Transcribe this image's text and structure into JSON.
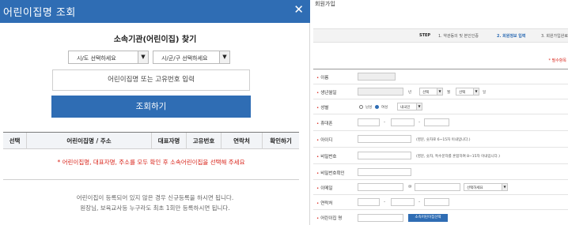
{
  "modal": {
    "title": "어린이집명 조회",
    "close_icon": "close-icon",
    "find_title": "소속기관(어린이집) 찾기",
    "sido_select": "시/도 선택하세요",
    "sigungu_select": "시/군/구 선택하세요",
    "name_input_placeholder": "어린이집명 또는 고유번호 입력",
    "search_button": "조회하기",
    "table_headers": [
      "선택",
      "어린이집명 / 주소",
      "대표자명",
      "고유번호",
      "연락처",
      "확인하기"
    ],
    "notice": "* 어린이집명, 대표자명, 주소를 모두 확인 후 소속어린이집을 선택해 주세요",
    "footer_line1": "어린이집이 등록되어 있지 않은 경우 신규등록을 하시면 됩니다.",
    "footer_line2": "원장님, 보육교사등 누구라도 최초 1회만 등록하시면 됩니다."
  },
  "signup": {
    "title": "회원가입",
    "step_label": "STEP",
    "steps": [
      "1. 약관동의 및 본인인증",
      "2. 회원정보 입력",
      "3. 회원가입완료"
    ],
    "active_step": 1,
    "required_note": "* 필수항목",
    "fields": {
      "name": "이름",
      "birth": "생년월일",
      "birth_year_unit": "년",
      "birth_month_select": "선택",
      "birth_month_unit": "월",
      "birth_day_select": "선택",
      "birth_day_unit": "일",
      "gender": "성별",
      "gender_male": "남성",
      "gender_female": "여성",
      "nationality_select": "내국인",
      "phone": "휴대폰",
      "user_id": "아이디",
      "user_id_hint": "(영문, 숫자로 6~15자 이내입니다.)",
      "password": "비밀번호",
      "password_hint": "(영문, 숫자, 특수문자를 혼합하여 8~15자 이내입니다.)",
      "password_confirm": "비밀번호확인",
      "email": "이메일",
      "email_at": "@",
      "email_domain_select": "선택하세요",
      "contact": "연락처",
      "daycare": "어린이집 명",
      "daycare_button": "소속어린이집선택"
    }
  },
  "colors": {
    "accent": "#2f6db4",
    "required": "#d9261c"
  }
}
